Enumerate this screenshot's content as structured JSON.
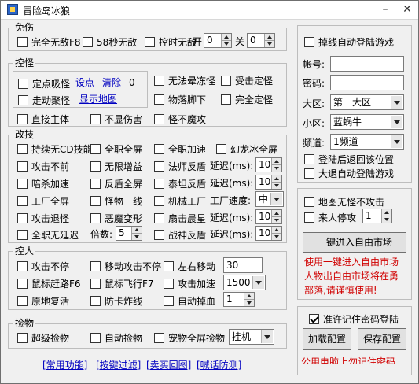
{
  "window": {
    "title": "冒险岛冰狼"
  },
  "mianshang": {
    "title": "免伤",
    "full_invincible": "完全无敌F8",
    "invincible_58": "58秒无敌",
    "timed_invincible": "控时无敌",
    "on_label": "开",
    "on_value": "0",
    "off_label": "关",
    "off_value": "0"
  },
  "guaiwu": {
    "title": "控怪",
    "fixed_suck": "定点吸怪",
    "set_point": "设点",
    "clear": "清除",
    "count": "0",
    "walk_gather": "走动聚怪",
    "show_map": "显示地图",
    "direct_host": "直接主体",
    "hide_damage": "不显伤害",
    "no_stun": "无法晕冻怪",
    "hit_fixed": "受击定怪",
    "drop_under": "物落脚下",
    "full_fixed": "完全定怪",
    "no_magic_attack": "怪不魔攻"
  },
  "gaiji": {
    "title": "改技",
    "rows": {
      "sustain_no_cd": "持续无CD技能",
      "full_screen_job": "全职全屏",
      "full_speed_job": "全职加速",
      "phantom_ice": "幻龙冰全屏",
      "attack_no_stop": "攻击不前",
      "unlimited_buff": "无限增益",
      "mage_reflect": "法师反盾",
      "delay_label": "延迟(ms):",
      "mage_delay": "100",
      "assassin_speed": "暗杀加速",
      "reflect_full": "反盾全屏",
      "taizu_reflect": "泰坦反盾",
      "taizu_delay": "100",
      "factory_full": "工厂全屏",
      "monster_line": "怪物一线",
      "mech_factory": "机械工厂",
      "factory_speed_label": "工厂速度:",
      "factory_speed": "中",
      "attack_retreat": "攻击退怪",
      "demon_transform": "恶魔变形",
      "fan_star": "扇击晨星",
      "fan_delay": "100",
      "full_no_delay": "全职无延迟",
      "multiplier_label": "倍数:",
      "multiplier": "5",
      "war_god_reflect": "战神反盾",
      "war_delay": "100"
    }
  },
  "kongren": {
    "title": "控人",
    "attack_no_stop": "攻击不停",
    "move_attack_no_stop": "移动攻击不停",
    "left_right_move": "左右移动",
    "move_value": "30",
    "mouse_kill_route": "鼠标赶路F6",
    "mouse_fly": "鼠标飞行F7",
    "attack_speed": "攻击加速",
    "speed_value": "1500",
    "resurrect_in_place": "原地复活",
    "anti_stuck_line": "防卡炸线",
    "auto_drop_blood": "自动掉血",
    "drop_value": "1"
  },
  "jianwu": {
    "title": "捡物",
    "super_pickup": "超级捡物",
    "auto_pickup": "自动捡物",
    "pet_full_pickup": "宠物全屏捡物",
    "mode": "挂机"
  },
  "bottom_links": [
    "[常用功能]",
    "[按键过滤]",
    "[卖买回图]",
    "[喊话防测]"
  ],
  "login": {
    "offline_auto_login": "掉线自动登陆游戏",
    "account_label": "帐号:",
    "account_value": "",
    "password_label": "密码:",
    "password_value": "",
    "region_label": "大区:",
    "region_value": "第一大区",
    "subregion_label": "小区:",
    "subregion_value": "蓝蜗牛",
    "channel_label": "频道:",
    "channel_value": "1频道",
    "return_position": "登陆后返回该位置",
    "exit_auto_login": "大退自动登陆游戏"
  },
  "market": {
    "map_no_attack": "地图无怪不攻击",
    "someone_stop": "来人停攻",
    "someone_value": "1",
    "enter_market_button": "一键进入自由市场",
    "note_line1": "使用一键进入自由市场",
    "note_line2": "人物出自由市场将在勇",
    "note_line3": "部落,请谨慎使用!"
  },
  "config": {
    "allow_remember_password": "准许记住密码登陆",
    "load_button": "加载配置",
    "save_button": "保存配置",
    "footer_note": "公用电脑上勿记住密码"
  },
  "colors": {
    "note_red": "#d00000",
    "link_blue": "#0000c0"
  }
}
